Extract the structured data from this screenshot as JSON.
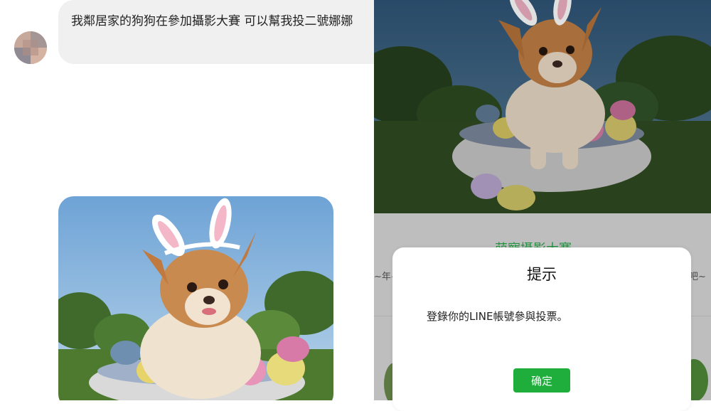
{
  "chat": {
    "message": "我鄰居家的狗狗在參加攝影大賽 可以幫我投二號娜娜"
  },
  "vote_page": {
    "contest_title": "萌寵攝影大賽",
    "left_snippet": "~年~",
    "right_snippet": "票吧~"
  },
  "dialog": {
    "title": "提示",
    "message": "登錄你的LINE帳號參與投票。",
    "confirm_label": "确定"
  },
  "colors": {
    "accent_green": "#1fae3c",
    "bubble_gray": "#f0f0f1"
  }
}
